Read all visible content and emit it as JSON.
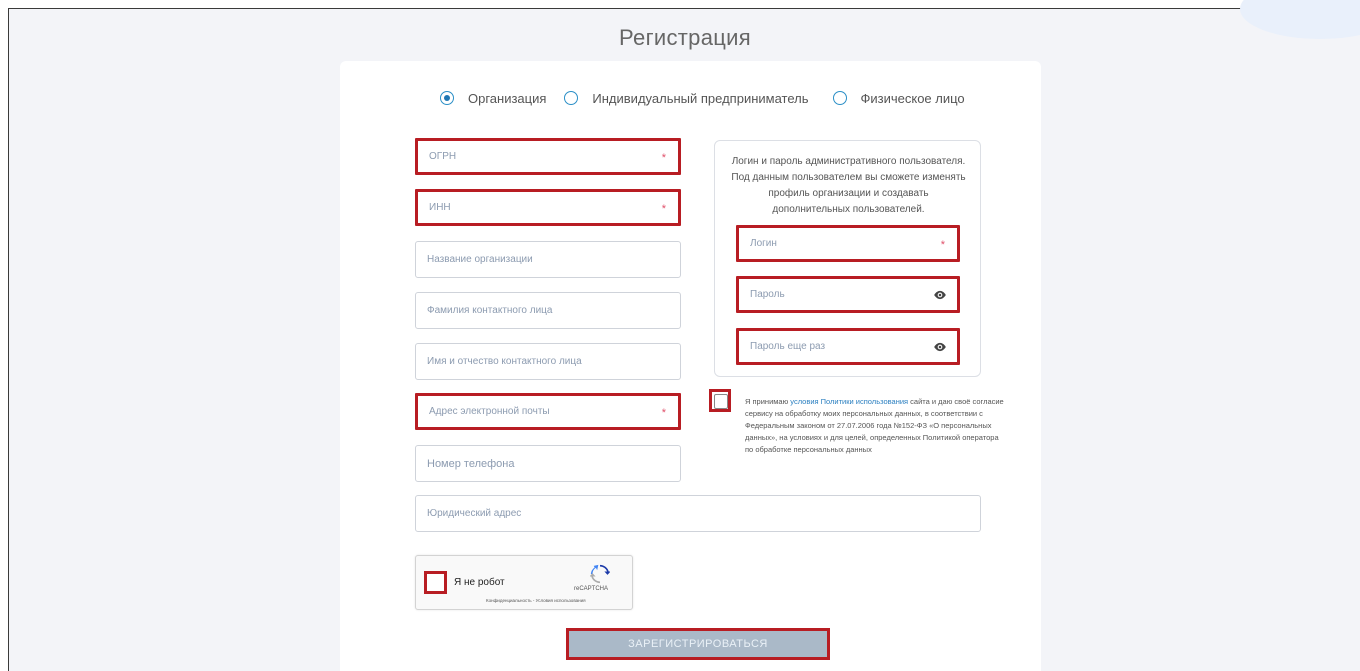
{
  "page": {
    "title": "Регистрация"
  },
  "account_type": {
    "options": [
      {
        "label": "Организация",
        "selected": true
      },
      {
        "label": "Индивидуальный предприниматель",
        "selected": false
      },
      {
        "label": "Физическое лицо",
        "selected": false
      }
    ]
  },
  "form": {
    "ogrn": {
      "placeholder": "ОГРН",
      "required_mark": "*"
    },
    "inn": {
      "placeholder": "ИНН",
      "required_mark": "*"
    },
    "org_name": {
      "placeholder": "Название организации"
    },
    "contact_surname": {
      "placeholder": "Фамилия контактного лица"
    },
    "contact_name": {
      "placeholder": "Имя и отчество контактного лица"
    },
    "email": {
      "placeholder": "Адрес электронной почты",
      "required_mark": "*"
    },
    "phone": {
      "placeholder": "Номер телефона"
    },
    "legal_address": {
      "placeholder": "Юридический адрес"
    }
  },
  "admin": {
    "description": "Логин и пароль административного пользователя. Под данным пользователем вы сможете изменять профиль организации и создавать дополнительных пользователей.",
    "login": {
      "placeholder": "Логин",
      "required_mark": "*"
    },
    "password": {
      "placeholder": "Пароль"
    },
    "password_repeat": {
      "placeholder": "Пароль еще раз"
    }
  },
  "consent": {
    "prefix": "Я принимаю ",
    "link": "условия Политики использования",
    "suffix": " сайта и даю своё согласие сервису на обработку моих персональных данных, в соответствии с Федеральным законом от 27.07.2006 года №152-ФЗ «О персональных данных», на условиях и для целей, определенных Политикой оператора по обработке персональных данных"
  },
  "captcha": {
    "label": "Я не робот",
    "brand": "reCAPTCHA",
    "links": "Конфиденциальность - Условия использования"
  },
  "submit": {
    "label": "ЗАРЕГИСТРИРОВАТЬСЯ"
  },
  "colors": {
    "highlight": "#b81d23",
    "accent": "#1f77b4",
    "button": "#aab9c8"
  }
}
